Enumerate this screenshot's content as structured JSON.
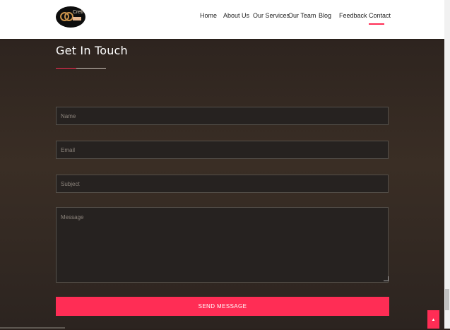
{
  "brand": {
    "logo_text": "Creti"
  },
  "nav": {
    "items": [
      {
        "label": "Home"
      },
      {
        "label": "About Us"
      },
      {
        "label": "Our Services"
      },
      {
        "label": "Our Team"
      },
      {
        "label": "Blog"
      },
      {
        "label": "Feedback"
      },
      {
        "label": "Contact"
      }
    ],
    "active": "Contact"
  },
  "section": {
    "title": "Get In Touch"
  },
  "form": {
    "name_placeholder": "Name",
    "email_placeholder": "Email",
    "subject_placeholder": "Subject",
    "message_placeholder": "Message",
    "submit_label": "SEND MESSAGE"
  },
  "colors": {
    "accent": "#ff2d55",
    "background": "#2f2621",
    "navbar": "#ffffff"
  },
  "icons": {
    "scroll_top": "arrow-up-icon"
  }
}
